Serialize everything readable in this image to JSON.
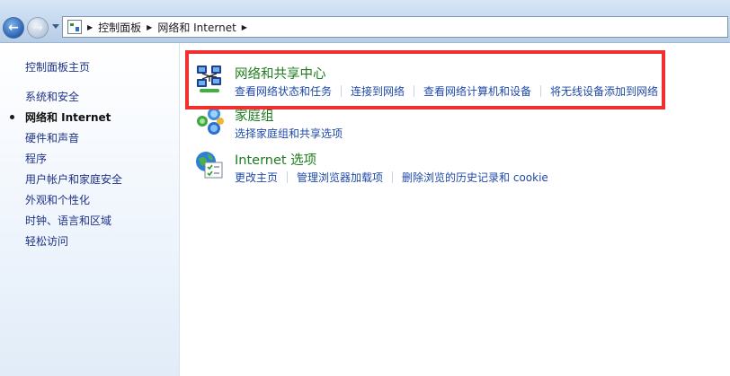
{
  "breadcrumb": {
    "items": [
      "控制面板",
      "网络和 Internet"
    ]
  },
  "sidebar": {
    "items": [
      {
        "label": "控制面板主页"
      },
      {
        "label": "系统和安全"
      },
      {
        "label": "网络和 Internet",
        "active": true
      },
      {
        "label": "硬件和声音"
      },
      {
        "label": "程序"
      },
      {
        "label": "用户帐户和家庭安全"
      },
      {
        "label": "外观和个性化"
      },
      {
        "label": "时钟、语言和区域"
      },
      {
        "label": "轻松访问"
      }
    ]
  },
  "sections": [
    {
      "title": "网络和共享中心",
      "icon": "network-sharing-icon",
      "links": [
        "查看网络状态和任务",
        "连接到网络",
        "查看网络计算机和设备",
        "将无线设备添加到网络"
      ]
    },
    {
      "title": "家庭组",
      "icon": "homegroup-icon",
      "links": [
        "选择家庭组和共享选项"
      ]
    },
    {
      "title": "Internet 选项",
      "icon": "internet-options-icon",
      "links": [
        "更改主页",
        "管理浏览器加载项",
        "删除浏览的历史记录和 cookie"
      ]
    }
  ],
  "colors": {
    "highlight": "#f12f2f",
    "link": "#1f49a8",
    "section_title": "#1e7b1e"
  }
}
